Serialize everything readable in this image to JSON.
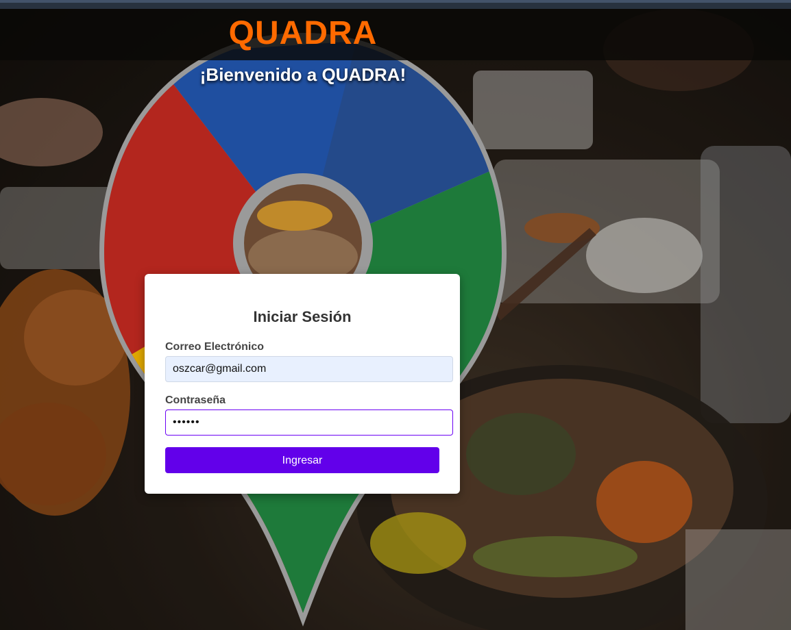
{
  "header": {
    "brand": "QUADRA"
  },
  "hero": {
    "welcome": "¡Bienvenido a QUADRA!"
  },
  "login": {
    "title": "Iniciar Sesión",
    "email_label": "Correo Electrónico",
    "email_value": "oszcar@gmail.com",
    "password_label": "Contraseña",
    "password_value": "••••••",
    "submit_label": "Ingresar"
  },
  "colors": {
    "brand": "#ff6a00",
    "button": "#6200ea",
    "input_focus_border": "#6a00f4",
    "pin_blue": "#1f4fa0",
    "pin_red": "#b3261e",
    "pin_yellow": "#e0a800",
    "pin_green": "#1e7a3a",
    "pin_outline": "#9a9a9a"
  },
  "icons": {
    "logo_pin": "map-pin-icon"
  }
}
